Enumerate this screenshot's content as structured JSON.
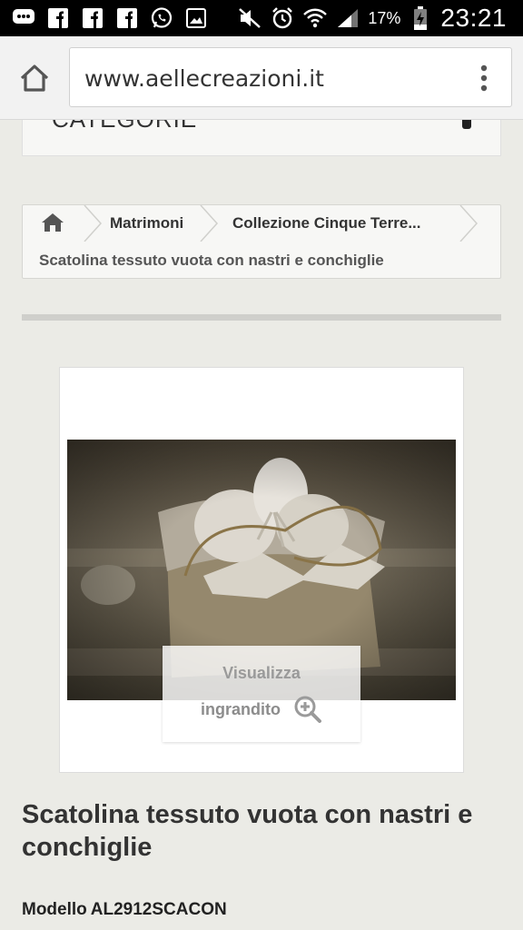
{
  "status_bar": {
    "icons": [
      "chat-icon",
      "facebook-icon",
      "facebook-icon",
      "facebook-icon",
      "whatsapp-icon",
      "gallery-icon",
      "mute-icon",
      "alarm-icon",
      "wifi-icon",
      "signal-icon"
    ],
    "battery": "17%",
    "time": "23:21"
  },
  "browser": {
    "url": "www.aellecreazioni.it",
    "icons": {
      "home": "home-icon",
      "menu": "more-vert-icon"
    }
  },
  "category": {
    "label": "CATEGORIE"
  },
  "breadcrumb": {
    "items": [
      "Matrimoni",
      "Collezione Cinque Terre..."
    ],
    "current": "Scatolina tessuto vuota con nastri e conchiglie"
  },
  "product": {
    "zoom_line1": "Visualizza",
    "zoom_line2": "ingrandito",
    "title": "Scatolina tessuto vuota con nastri e conchiglie",
    "model_label": "Modello",
    "model_code": "AL2912SCACON"
  },
  "colors": {
    "background": "#ebebe6",
    "status_bar": "#000000",
    "text_dark": "#333333"
  }
}
